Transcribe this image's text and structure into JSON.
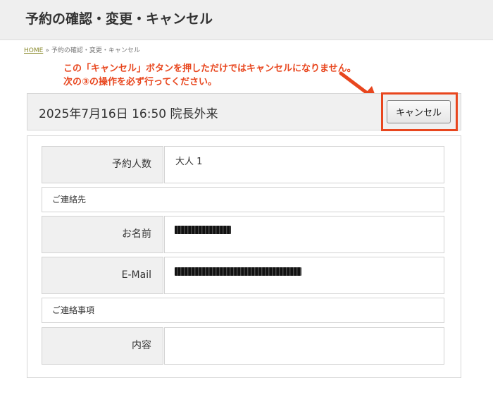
{
  "header": {
    "title": "予約の確認・変更・キャンセル"
  },
  "breadcrumb": {
    "home": "HOME",
    "separator": "»",
    "current": "予約の確認・変更・キャンセル"
  },
  "notice": {
    "line1": "この「キャンセル」ボタンを押しただけではキャンセルになりません。",
    "line2": "次の③の操作を必ず行ってください。",
    "color": "#e8461e"
  },
  "reservation": {
    "title": "2025年7月16日 16:50 院長外来",
    "cancel_label": "キャンセル"
  },
  "form": {
    "party_size_label": "予約人数",
    "party_size_value": "大人 1",
    "contact_section": "ご連絡先",
    "name_label": "お名前",
    "email_label": "E-Mail",
    "notes_section": "ご連絡事項",
    "content_label": "内容",
    "content_value": ""
  }
}
